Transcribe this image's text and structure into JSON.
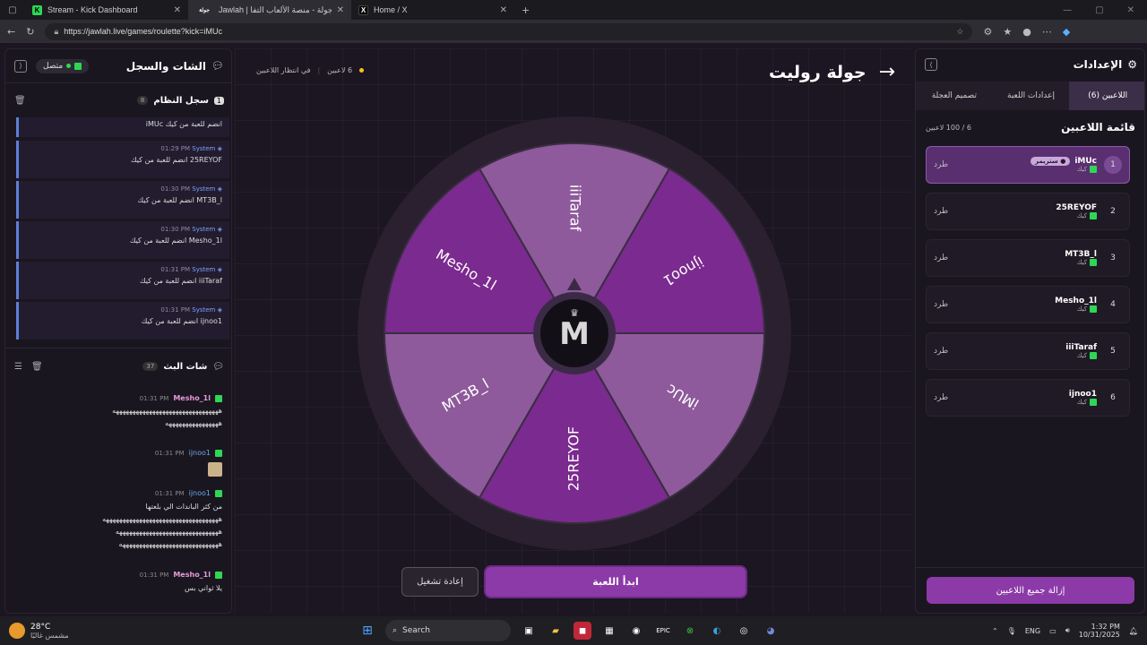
{
  "browser": {
    "tabs": [
      {
        "title": "Stream - Kick Dashboard",
        "icon": "kick-icon"
      },
      {
        "title": "Jawlah | جولة - منصة الألعاب التفا...",
        "icon": "jawlah-icon",
        "fav_text": "جولة"
      },
      {
        "title": "Home / X",
        "icon": "x-icon"
      }
    ],
    "url": "https://jawlah.live/games/roulette?kick=iMUc"
  },
  "left_panel": {
    "title": "الشات والسجل",
    "status": "متصل",
    "log": {
      "title": "سجل النظام",
      "count": "8",
      "badge": "1",
      "first_msg": "iMUc انضم للعبة من كيك",
      "entries": [
        {
          "time": "01:29 PM",
          "who": "System",
          "msg": "25REYOF انضم للعبة من كيك"
        },
        {
          "time": "01:30 PM",
          "who": "System",
          "msg": "MT3B_l انضم للعبة من كيك"
        },
        {
          "time": "01:30 PM",
          "who": "System",
          "msg": "Mesho_1l انضم للعبة من كيك"
        },
        {
          "time": "01:31 PM",
          "who": "System",
          "msg": "iiiTaraf انضم للعبة من كيك"
        },
        {
          "time": "01:31 PM",
          "who": "System",
          "msg": "ijnoo1 انضم للعبة من كيك"
        }
      ]
    },
    "chat": {
      "title": "شات البث",
      "count": "37",
      "messages": [
        {
          "user": "Mesho_1l",
          "time": "01:31 PM",
          "lines": [
            "ههههههههههههههههههههههههههههههههه",
            "ههههههههههههههههه"
          ]
        },
        {
          "user": "ijnoo1",
          "time": "01:31 PM",
          "lines": []
        },
        {
          "user": "ijnoo1",
          "time": "01:31 PM",
          "lines": [
            "من كثر الباندات الي بلعتها",
            "هههههههههههههههههههههههههههههههههههه",
            "هههههههههههههههههههههههههههههههه",
            "ههههههههههههههههههههههههههههههه"
          ]
        },
        {
          "user": "Mesho_1l",
          "time": "01:31 PM",
          "lines": [
            "يلا ثواني بس"
          ]
        }
      ]
    }
  },
  "center": {
    "title": "جولة روليت",
    "players_count": "6 لاعبين",
    "status": "في انتظار اللاعبين",
    "segments": [
      "iiiTaraf",
      "ijnoo1",
      "iMUc",
      "25REYOF",
      "MT3B_l",
      "Mesho_1l"
    ],
    "start_button": "ابدأ اللعبة",
    "restart_button": "إعادة تشغيل",
    "colors": {
      "purple_dark": "#7b2a8f",
      "purple_light": "#8e5a9b",
      "accent": "#9a3fb3"
    }
  },
  "right_panel": {
    "title": "الإعدادات",
    "tabs": [
      "اللاعبين (6)",
      "إعدادات اللعبة",
      "تصميم العجلة"
    ],
    "list_title": "قائمة اللاعبين",
    "capacity": "6 / 100 لاعبين",
    "streamer_badge": "ستريمر",
    "kick_label": "كيك",
    "kick_action": "طرد",
    "players": [
      {
        "num": "1",
        "name": "iMUc"
      },
      {
        "num": "2",
        "name": "25REYOF"
      },
      {
        "num": "3",
        "name": "MT3B_l"
      },
      {
        "num": "4",
        "name": "Mesho_1l"
      },
      {
        "num": "5",
        "name": "iiiTaraf"
      },
      {
        "num": "6",
        "name": "ijnoo1"
      }
    ],
    "remove_all": "إزالة جميع اللاعبين"
  },
  "taskbar": {
    "weather_temp": "28°C",
    "weather_desc": "مشمس غالبًا",
    "search": "Search",
    "lang": "ENG",
    "time": "1:32 PM",
    "date": "10/31/2025"
  }
}
